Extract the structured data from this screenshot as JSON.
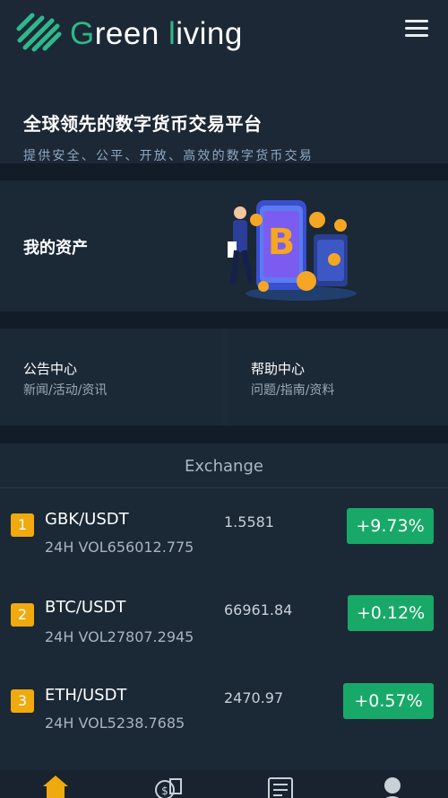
{
  "brand": {
    "name_g": "G",
    "name_reen": "reen ",
    "name_l": "l",
    "name_iving": "iving"
  },
  "hero": {
    "title": "全球领先的数字货币交易平台",
    "subtitle": "提供安全、公平、开放、高效的数字货币交易"
  },
  "assets": {
    "title": "我的资产"
  },
  "tiles": [
    {
      "title": "公告中心",
      "subtitle": "新闻/活动/资讯"
    },
    {
      "title": "帮助中心",
      "subtitle": "问题/指南/资料"
    }
  ],
  "exchange": {
    "title": "Exchange",
    "rows": [
      {
        "rank": "1",
        "pair": "GBK/USDT",
        "volume": "24H VOL656012.775",
        "price": "1.5581",
        "change": "+9.73%"
      },
      {
        "rank": "2",
        "pair": "BTC/USDT",
        "volume": "24H VOL27807.2945",
        "price": "66961.84",
        "change": "+0.12%"
      },
      {
        "rank": "3",
        "pair": "ETH/USDT",
        "volume": "24H VOL5238.7685",
        "price": "2470.97",
        "change": "+0.57%"
      }
    ]
  },
  "colors": {
    "background": "#1d2a37",
    "accent": "#2fb88a",
    "rank_badge": "#f0a90e",
    "change_up": "#18a968",
    "nav_active": "#f0a90e"
  },
  "icons": {
    "menu": "hamburger-icon",
    "nav": [
      "home-icon",
      "coin-trade-icon",
      "orders-icon",
      "user-icon"
    ]
  }
}
